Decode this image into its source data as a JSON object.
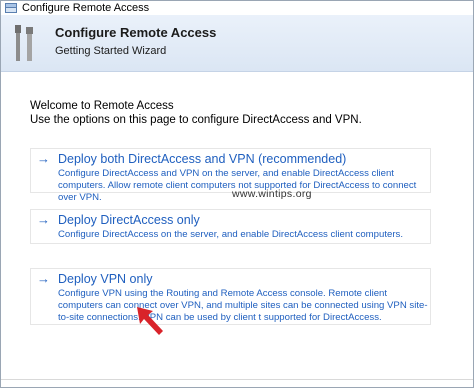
{
  "window": {
    "title": "Configure Remote Access"
  },
  "banner": {
    "title": "Configure Remote Access",
    "subtitle": "Getting Started Wizard"
  },
  "intro": {
    "line1": "Welcome to Remote Access",
    "line2": "Use the options on this page to configure DirectAccess and VPN."
  },
  "options": [
    {
      "arrow": "→",
      "title": "Deploy both DirectAccess and VPN (recommended)",
      "description": "Configure DirectAccess and VPN on the server, and enable DirectAccess client computers. Allow remote client computers not supported for DirectAccess to connect over VPN."
    },
    {
      "arrow": "→",
      "title": "Deploy DirectAccess only",
      "description": "Configure DirectAccess on the server, and enable DirectAccess client computers."
    },
    {
      "arrow": "→",
      "title": "Deploy VPN only",
      "description": "Configure VPN using the Routing and Remote Access console. Remote client computers can connect over VPN, and multiple sites can be connected using VPN site-to-site connections. VPN can be used by client     t supported for DirectAccess."
    }
  ],
  "watermark": "www.wintips.org",
  "colors": {
    "link": "#1f5fbf",
    "banner_top": "#eaf1fa",
    "banner_bottom": "#dbe6f4",
    "annotation_arrow": "#d9232a"
  },
  "icons": {
    "title": "server-tools-icon",
    "banner": "wrench-screwdriver-icon",
    "annotation": "red-pointer-arrow"
  }
}
